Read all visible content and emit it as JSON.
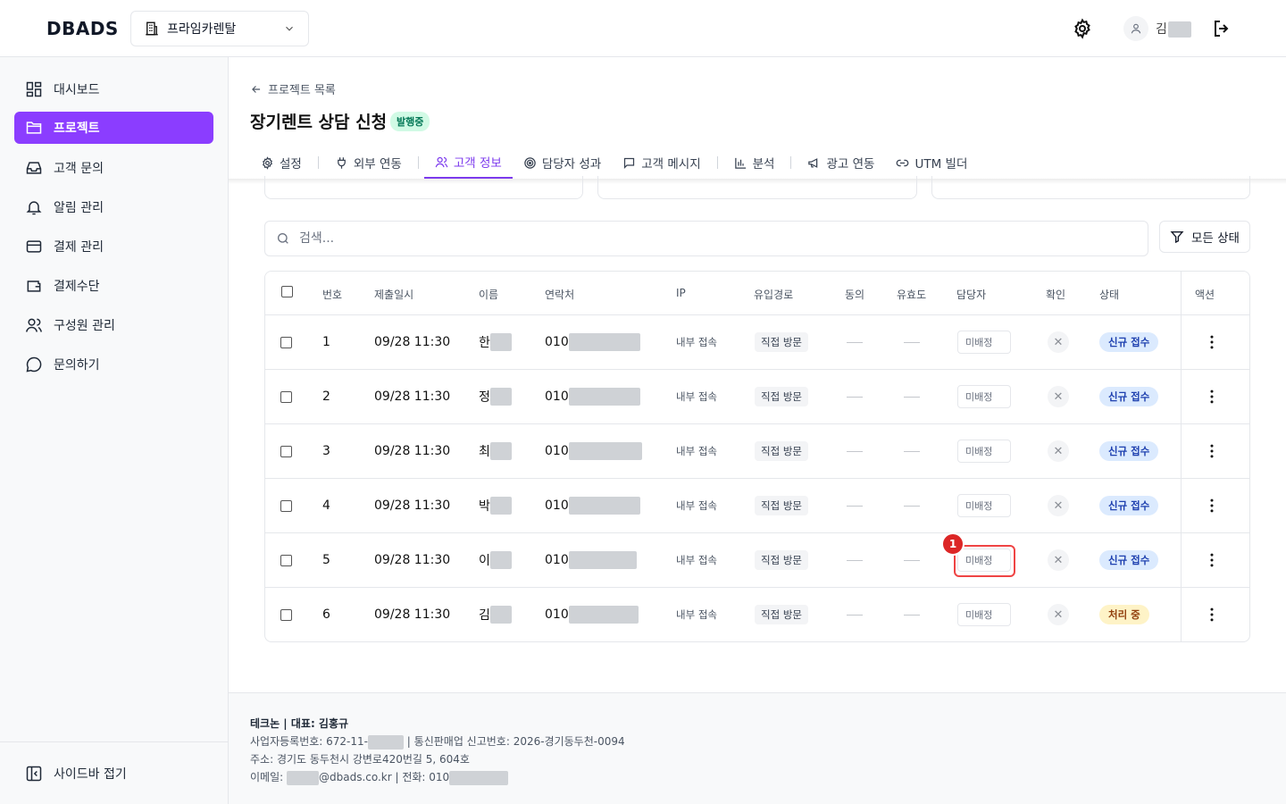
{
  "app": {
    "logo": "DBADS"
  },
  "org_selector": {
    "label": "프라임카렌탈"
  },
  "user": {
    "name_prefix": "김"
  },
  "sidebar": {
    "items": [
      {
        "label": "대시보드",
        "icon": "dashboard-icon"
      },
      {
        "label": "프로젝트",
        "icon": "folder-icon",
        "active": true
      },
      {
        "label": "고객 문의",
        "icon": "inbox-icon"
      },
      {
        "label": "알림 관리",
        "icon": "bell-icon"
      },
      {
        "label": "결제 관리",
        "icon": "card-icon"
      },
      {
        "label": "결제수단",
        "icon": "wallet-icon"
      },
      {
        "label": "구성원 관리",
        "icon": "users-icon"
      },
      {
        "label": "문의하기",
        "icon": "chat-icon"
      }
    ],
    "collapse_label": "사이드바 접기"
  },
  "breadcrumb": {
    "back_label": "프로젝트 목록"
  },
  "page": {
    "title": "장기렌트 상담 신청",
    "status_badge": "발행중"
  },
  "tabs": [
    {
      "label": "설정"
    },
    {
      "label": "외부 연동"
    },
    {
      "label": "고객 정보",
      "active": true
    },
    {
      "label": "담당자 성과"
    },
    {
      "label": "고객 메시지"
    },
    {
      "label": "분석"
    },
    {
      "label": "광고 연동"
    },
    {
      "label": "UTM 빌더"
    }
  ],
  "search": {
    "placeholder": "검색..."
  },
  "filter": {
    "label": "모든 상태"
  },
  "table": {
    "headers": [
      "번호",
      "제출일시",
      "이름",
      "연락처",
      "IP",
      "유입경로",
      "동의",
      "유효도",
      "담당자",
      "확인",
      "상태",
      "액션"
    ],
    "rows": [
      {
        "no": "1",
        "date": "09/28 11:30",
        "name": "한",
        "phone": "010",
        "ip": "내부 접속",
        "source": "직접 방문",
        "assignee": "미배정",
        "status": "신규 접수",
        "status_type": "new"
      },
      {
        "no": "2",
        "date": "09/28 11:30",
        "name": "정",
        "phone": "010",
        "ip": "내부 접속",
        "source": "직접 방문",
        "assignee": "미배정",
        "status": "신규 접수",
        "status_type": "new"
      },
      {
        "no": "3",
        "date": "09/28 11:30",
        "name": "최",
        "phone": "010",
        "ip": "내부 접속",
        "source": "직접 방문",
        "assignee": "미배정",
        "status": "신규 접수",
        "status_type": "new"
      },
      {
        "no": "4",
        "date": "09/28 11:30",
        "name": "박",
        "phone": "010",
        "ip": "내부 접속",
        "source": "직접 방문",
        "assignee": "미배정",
        "status": "신규 접수",
        "status_type": "new"
      },
      {
        "no": "5",
        "date": "09/28 11:30",
        "name": "이",
        "phone": "010",
        "ip": "내부 접속",
        "source": "직접 방문",
        "assignee": "미배정",
        "status": "신규 접수",
        "status_type": "new"
      },
      {
        "no": "6",
        "date": "09/28 11:30",
        "name": "김",
        "phone": "010",
        "ip": "내부 접속",
        "source": "직접 방문",
        "assignee": "미배정",
        "status": "처리 중",
        "status_type": "processing"
      }
    ]
  },
  "annotation": {
    "marker": "1"
  },
  "footer": {
    "company": "테크논 | 대표: 김홍규",
    "biz_prefix": "사업자등록번호: 672-11-",
    "biz_suffix": " | 통신판매업 신고번호: 2026-경기동두천-0094",
    "address": "주소: 경기도 동두천시 강변로420번길 5, 604호",
    "email_prefix": "이메일: ",
    "email_suffix": "@dbads.co.kr | 전화: 010"
  },
  "colors": {
    "accent": "#8b3dff",
    "tab_active": "#7c3aed",
    "highlight": "#ef4444",
    "status_new_bg": "#dbeafe",
    "status_processing_bg": "#fef3c7"
  }
}
